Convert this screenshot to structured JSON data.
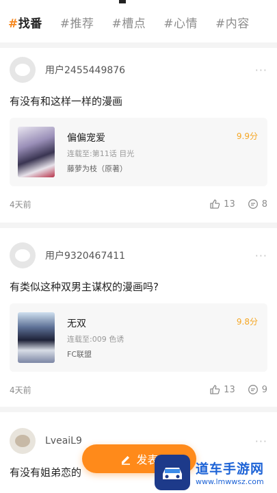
{
  "tabs": [
    {
      "hash": "#",
      "label": "找番",
      "active": true
    },
    {
      "hash": "#",
      "label": "推荐"
    },
    {
      "hash": "#",
      "label": "槽点"
    },
    {
      "hash": "#",
      "label": "心情"
    },
    {
      "hash": "#",
      "label": "内容"
    }
  ],
  "posts": [
    {
      "username": "用户2455449876",
      "more": "···",
      "question": "有没有和这样一样的漫画",
      "comic": {
        "title": "偏偏宠爱",
        "progress": "连载至:第11话 目光",
        "author": "藤萝为枝（原著）",
        "score": "9.9分"
      },
      "time": "4天前",
      "likes": "13",
      "comments": "8"
    },
    {
      "username": "用户9320467411",
      "more": "···",
      "question": "有类似这种双男主谋权的漫画吗?",
      "comic": {
        "title": "无双",
        "progress": "连载至:009 色诱",
        "author": "FC联盟",
        "score": "9.8分"
      },
      "time": "4天前",
      "likes": "13",
      "comments": "9"
    },
    {
      "username": "LveaiL9",
      "more": "···",
      "question": "有没有姐弟恋的"
    }
  ],
  "fab": {
    "label": "发表"
  },
  "watermark": {
    "title": "道车手游网",
    "url": "www.lmwwsz.com"
  },
  "colors": {
    "accent": "#f5871f",
    "score": "#f5a623",
    "fab": "#ff8a1a"
  }
}
